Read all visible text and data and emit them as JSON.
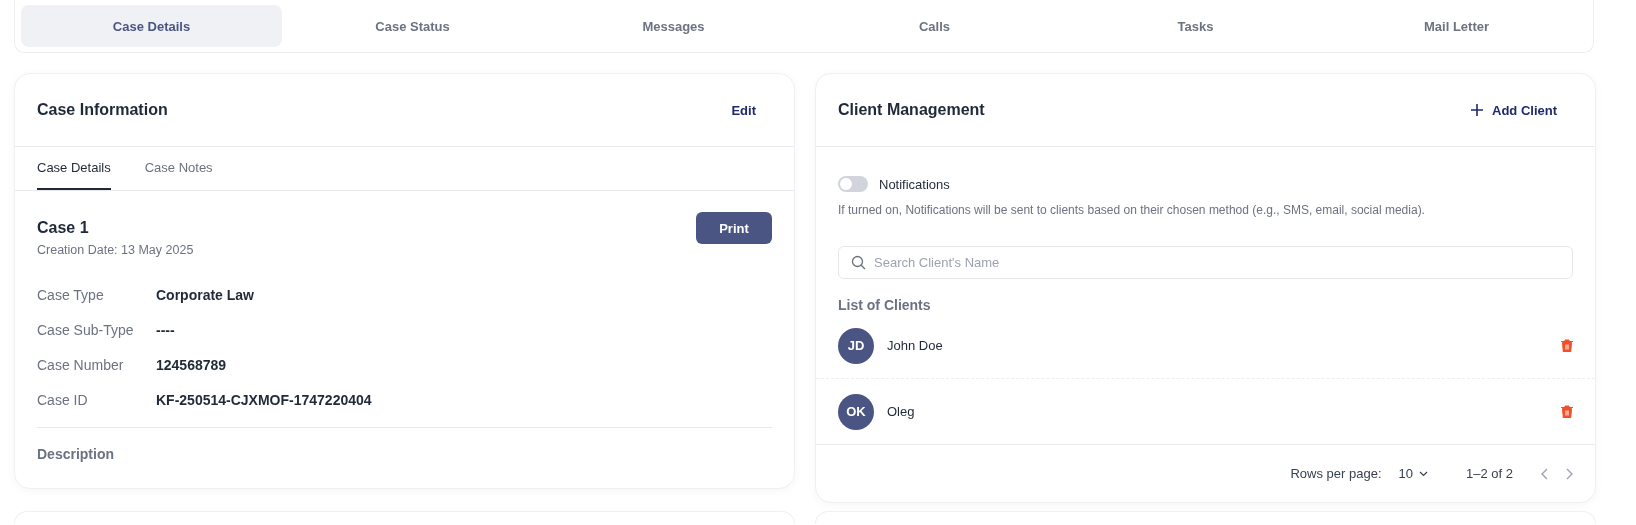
{
  "tabs": [
    {
      "label": "Case Details",
      "selected": true
    },
    {
      "label": "Case Status",
      "selected": false
    },
    {
      "label": "Messages",
      "selected": false
    },
    {
      "label": "Calls",
      "selected": false
    },
    {
      "label": "Tasks",
      "selected": false
    },
    {
      "label": "Mail Letter",
      "selected": false
    }
  ],
  "case_information": {
    "title": "Case Information",
    "edit": "Edit",
    "subtabs": [
      {
        "label": "Case Details",
        "selected": true
      },
      {
        "label": "Case Notes",
        "selected": false
      }
    ],
    "case_title": "Case 1",
    "creation_date": "Creation Date: 13 May 2025",
    "print": "Print",
    "fields": [
      {
        "label": "Case Type",
        "value": "Corporate Law"
      },
      {
        "label": "Case Sub-Type",
        "value": "----"
      },
      {
        "label": "Case Number",
        "value": "124568789"
      },
      {
        "label": "Case ID",
        "value": "KF-250514-CJXMOF-1747220404"
      }
    ],
    "description_label": "Description"
  },
  "client_management": {
    "title": "Client Management",
    "add_client": "Add Client",
    "notifications": {
      "label": "Notifications",
      "on": false
    },
    "notifications_hint": "If turned on, Notifications will be sent to clients based on their chosen method (e.g., SMS, email, social media).",
    "search": {
      "placeholder": "Search Client's Name"
    },
    "list_title": "List of Clients",
    "clients": [
      {
        "initials": "JD",
        "name": "John Doe"
      },
      {
        "initials": "OK",
        "name": "Oleg"
      }
    ],
    "pagination": {
      "rows_label": "Rows per page:",
      "rows_value": "10",
      "range": "1–2 of 2"
    }
  }
}
